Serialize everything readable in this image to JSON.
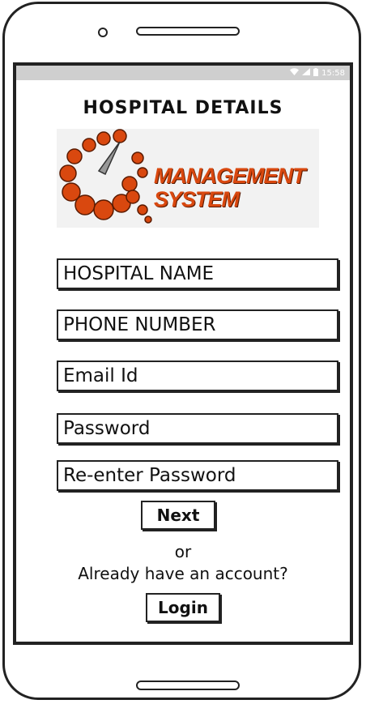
{
  "status_bar": {
    "time": "15:58"
  },
  "page": {
    "title": "HOSPITAL DETAILS"
  },
  "logo": {
    "line1": "MANAGEMENT",
    "line2": "SYSTEM"
  },
  "form": {
    "hospital_name": "HOSPITAL NAME",
    "phone_number": "PHONE NUMBER",
    "email": "Email Id",
    "password": "Password",
    "reenter_password": "Re-enter Password"
  },
  "buttons": {
    "next": "Next",
    "login": "Login"
  },
  "footer": {
    "or": "or",
    "account_prompt": "Already have an account?"
  },
  "colors": {
    "logo_orange": "#d9480f",
    "status_bar": "#cfcfcf"
  }
}
